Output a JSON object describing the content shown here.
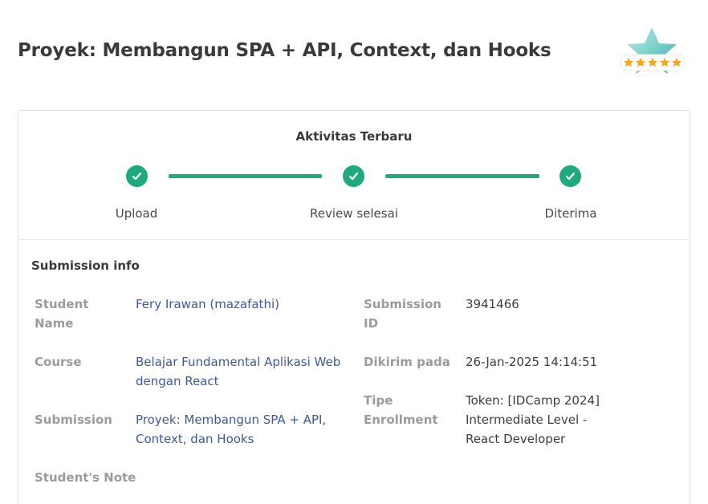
{
  "page": {
    "title": "Proyek: Membangun SPA + API, Context, dan Hooks"
  },
  "badge": {
    "icon": "rating-star-badge-icon",
    "stars": 5
  },
  "activity": {
    "title": "Aktivitas Terbaru",
    "steps": [
      {
        "label": "Upload",
        "status": "done"
      },
      {
        "label": "Review selesai",
        "status": "done"
      },
      {
        "label": "Diterima",
        "status": "done"
      }
    ],
    "accent": "#1faa7b"
  },
  "submission_info": {
    "title": "Submission info",
    "student_name": {
      "label1": "Student",
      "label2": "Name",
      "value": "Fery Irawan (mazafathi)"
    },
    "course": {
      "label": "Course",
      "value1": "Belajar Fundamental Aplikasi Web",
      "value2": "dengan React"
    },
    "submission": {
      "label": "Submission",
      "value1": "Proyek: Membangun SPA + API,",
      "value2": "Context, dan Hooks"
    },
    "student_note": {
      "label": "Student's Note"
    },
    "submission_id": {
      "label1": "Submission",
      "label2": "ID",
      "value": "3941466"
    },
    "sent_at": {
      "label": "Dikirim pada",
      "value": "26-Jan-2025 14:14:51"
    },
    "enrollment": {
      "label1": "Tipe",
      "label2": "Enrollment",
      "value1": "Token: [IDCamp 2024]",
      "value2": "Intermediate Level -",
      "value3": "React Developer"
    }
  },
  "colors": {
    "link": "#3c5a99",
    "label": "#9b9b9b",
    "text": "#3d3d3d"
  }
}
